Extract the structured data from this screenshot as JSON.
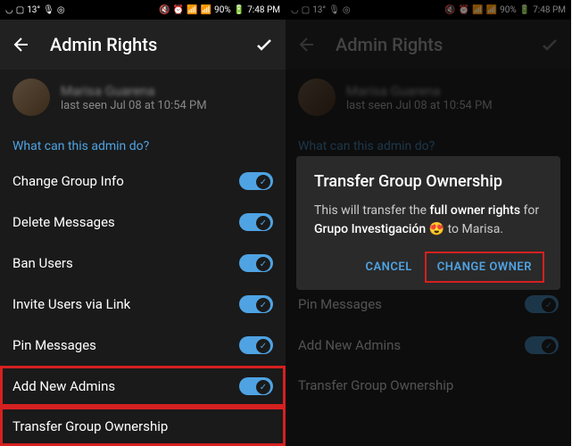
{
  "status": {
    "temp": "13°",
    "battery": "90%",
    "time": "7:48 PM"
  },
  "header": {
    "title": "Admin Rights"
  },
  "user": {
    "name": "Marisa Guarena",
    "status": "last seen Jul 08 at 10:54 PM"
  },
  "section": {
    "title": "What can this admin do?"
  },
  "perms": {
    "changeInfo": "Change Group Info",
    "deleteMsgs": "Delete Messages",
    "banUsers": "Ban Users",
    "inviteLink": "Invite Users via Link",
    "pinMsgs": "Pin Messages",
    "addAdmins": "Add New Admins",
    "transfer": "Transfer Group Ownership"
  },
  "dialog": {
    "title": "Transfer Group Ownership",
    "body_prefix": "This will transfer the ",
    "body_bold1": "full owner rights",
    "body_mid": " for ",
    "body_bold2": "Grupo Investigación 😍",
    "body_suffix": " to Marisa.",
    "cancel": "CANCEL",
    "confirm": "CHANGE OWNER"
  }
}
